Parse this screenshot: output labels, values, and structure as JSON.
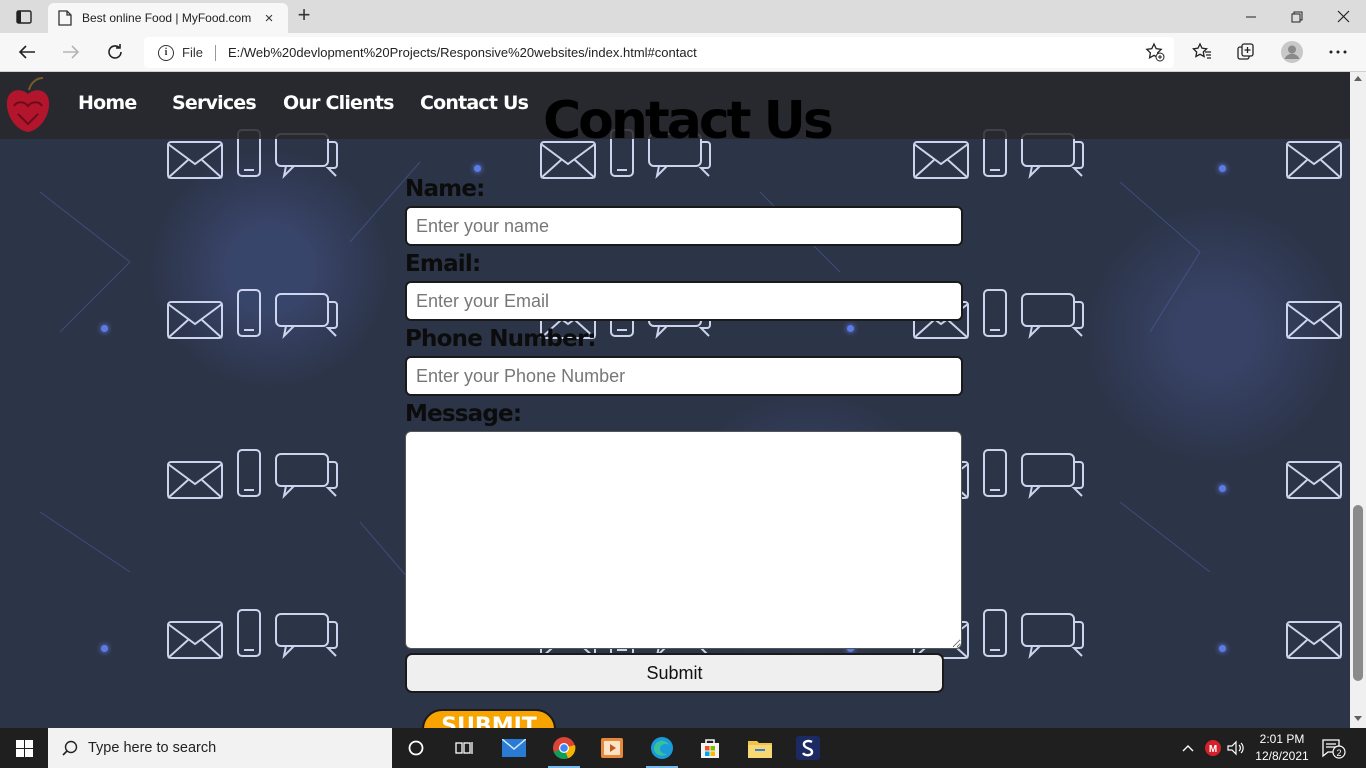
{
  "browser": {
    "tab_title": "Best online Food | MyFood.com",
    "tab_close": "×",
    "new_tab": "+",
    "scheme_label": "File",
    "url": "E:/Web%20devlopment%20Projects/Responsive%20websites/index.html#contact"
  },
  "site": {
    "nav": [
      "Home",
      "Services",
      "Our Clients",
      "Contact Us"
    ],
    "heading": "Contact Us",
    "form": {
      "name_label": "Name:",
      "name_placeholder": "Enter your name",
      "email_label": "Email:",
      "email_placeholder": "Enter your Email",
      "phone_label": "Phone Number:",
      "phone_placeholder": "Enter your Phone Number",
      "message_label": "Message:",
      "submit_label": "Submit",
      "submit2_label": "SUBMIT"
    }
  },
  "taskbar": {
    "search_placeholder": "Type here to search",
    "time": "2:01 PM",
    "date": "12/8/2021",
    "notification_count": "2",
    "tray_badge": "M"
  },
  "colors": {
    "nav_bg": "#28282c",
    "page_bg": "#2c3448",
    "submit2_bg": "#f7a400",
    "taskbar_bg": "#1f1f1f"
  }
}
